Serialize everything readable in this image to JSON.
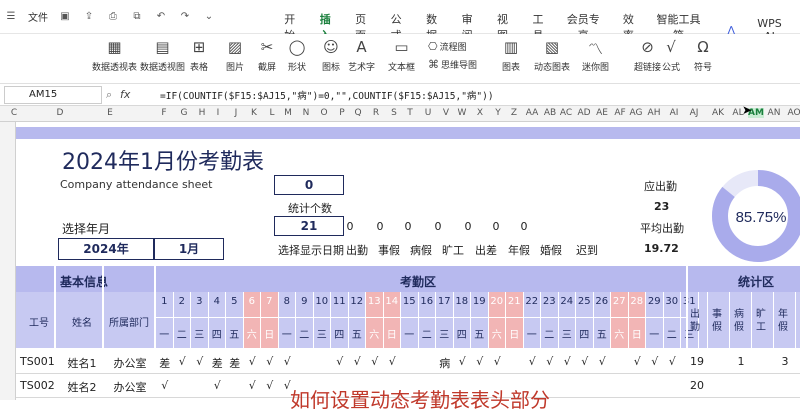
{
  "tabbar": {
    "file_label": "文件",
    "menus": [
      "开始",
      "插入",
      "页面",
      "公式",
      "数据",
      "审阅",
      "视图",
      "工具",
      "会员专享",
      "效率",
      "智能工具箱"
    ],
    "active_menu": "插入",
    "wps_ai": "WPS AI"
  },
  "ribbon": {
    "items": [
      {
        "label": "数据透视表",
        "icon": "pivot-table-icon"
      },
      {
        "label": "数据透视图",
        "icon": "pivot-chart-icon"
      },
      {
        "label": "表格",
        "icon": "table-icon"
      },
      {
        "label": "图片",
        "icon": "picture-icon"
      },
      {
        "label": "截屏",
        "icon": "screenshot-icon"
      },
      {
        "label": "形状",
        "icon": "shape-icon"
      },
      {
        "label": "图标",
        "icon": "icon-library-icon"
      },
      {
        "label": "艺术字",
        "icon": "wordart-icon"
      },
      {
        "label": "文本框",
        "icon": "textbox-icon"
      },
      {
        "label": "流程图",
        "icon": "flowchart-icon"
      },
      {
        "label": "思维导图",
        "icon": "mindmap-icon"
      },
      {
        "label": "图表",
        "icon": "chart-icon"
      },
      {
        "label": "动态图表",
        "icon": "dynamic-chart-icon"
      },
      {
        "label": "迷你图",
        "icon": "sparkline-icon"
      },
      {
        "label": "超链接",
        "icon": "hyperlink-icon"
      },
      {
        "label": "公式",
        "icon": "formula-icon"
      },
      {
        "label": "符号",
        "icon": "symbol-icon"
      }
    ]
  },
  "formula_bar": {
    "cell": "AM15",
    "fx": "fx",
    "formula": "=IF(COUNTIF($F15:$AJ15,\"病\")=0,\"\",COUNTIF($F15:$AJ15,\"病\"))"
  },
  "columns": [
    "C",
    "D",
    "E",
    "F",
    "G",
    "H",
    "I",
    "J",
    "K",
    "L",
    "M",
    "N",
    "O",
    "P",
    "Q",
    "R",
    "S",
    "T",
    "U",
    "V",
    "W",
    "X",
    "Y",
    "Z",
    "AA",
    "AB",
    "AC",
    "AD",
    "AE",
    "AF",
    "AG",
    "AH",
    "AI",
    "AJ",
    "AK",
    "AL",
    "AM",
    "AN",
    "AO"
  ],
  "sheet": {
    "title": "2024年1月份考勤表",
    "subtitle": "Company attendance sheet",
    "select_label": "选择年月",
    "year": "2024年",
    "month": "1月",
    "count_value": "0",
    "count_label": "统计个数",
    "days_value": "21",
    "select_display_label": "选择显示日期",
    "zeros": [
      "0",
      "0",
      "0",
      "0",
      "0",
      "0",
      "0"
    ],
    "categories": [
      "出勤",
      "事假",
      "病假",
      "旷工",
      "出差",
      "年假",
      "婚假",
      "迟到"
    ],
    "should_attend_label": "应出勤",
    "should_attend": "23",
    "avg_label": "平均出勤",
    "avg": "19.72",
    "rate": "85.75%",
    "rate_value": 0.8575,
    "group_basic": "基本信息",
    "group_attend": "考勤区",
    "group_stats": "统计区",
    "col_id": "工号",
    "col_name": "姓名",
    "col_dept": "所属部门",
    "days": [
      "1",
      "2",
      "3",
      "4",
      "5",
      "6",
      "7",
      "8",
      "9",
      "10",
      "11",
      "12",
      "13",
      "14",
      "15",
      "16",
      "17",
      "18",
      "19",
      "20",
      "21",
      "22",
      "23",
      "24",
      "25",
      "26",
      "27",
      "28",
      "29",
      "30",
      "31"
    ],
    "weekdays": [
      "一",
      "二",
      "三",
      "四",
      "五",
      "六",
      "日",
      "一",
      "二",
      "三",
      "四",
      "五",
      "六",
      "日",
      "一",
      "二",
      "三",
      "四",
      "五",
      "六",
      "日",
      "一",
      "二",
      "三",
      "四",
      "五",
      "六",
      "日",
      "一",
      "二",
      "三"
    ],
    "stat_cols": [
      "出勤",
      "事假",
      "病假",
      "旷工",
      "年假"
    ],
    "rows": [
      {
        "id": "TS001",
        "name": "姓名1",
        "dept": "办公室",
        "marks": [
          "差",
          "√",
          "√",
          "差",
          "差",
          "√",
          "√",
          "√",
          "",
          "",
          "√",
          "√",
          "√",
          "√",
          "",
          "",
          "病",
          "√",
          "√",
          "√",
          "",
          "√",
          "√",
          "√",
          "√",
          "√",
          "",
          "√",
          "√",
          "√",
          ""
        ],
        "stats": [
          "19",
          "",
          "1",
          "",
          "3"
        ]
      },
      {
        "id": "TS002",
        "name": "姓名2",
        "dept": "办公室",
        "marks": [
          "√",
          "",
          "",
          "√",
          "",
          "√",
          "√",
          "√",
          "",
          "",
          "",
          "",
          "",
          "",
          "",
          "",
          "",
          "",
          "",
          "",
          "",
          "",
          "",
          "",
          "",
          "",
          "",
          "",
          "",
          "",
          ""
        ],
        "stats": [
          "20",
          "",
          "",
          "",
          ""
        ]
      }
    ],
    "overlay_text": "如何设置动态考勤表表头部分",
    "accent": "#b7b9ee",
    "weekend_color": "#f2b5b5"
  }
}
